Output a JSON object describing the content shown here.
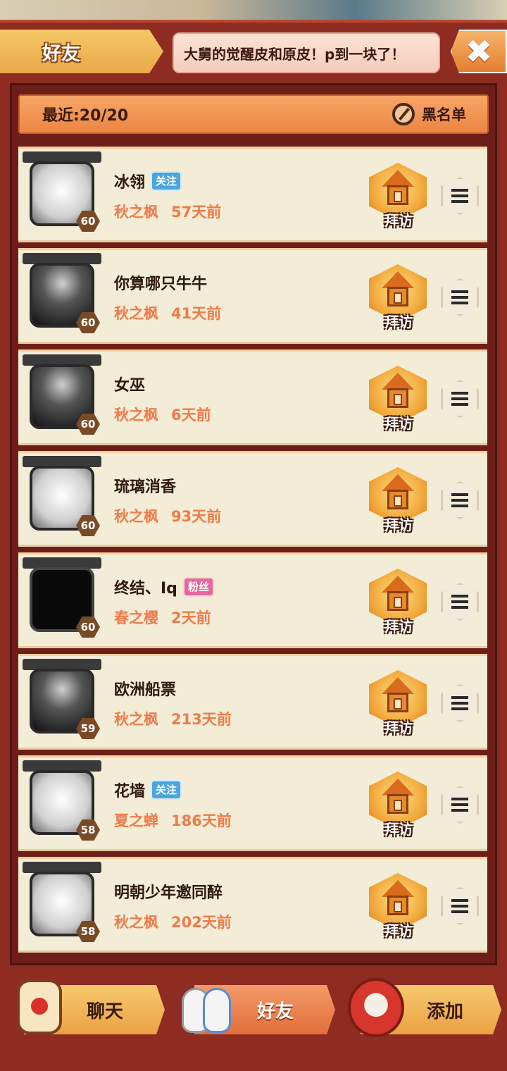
{
  "header": {
    "title": "好友",
    "marquee": "大舅的觉醒皮和原皮！p到一块了！",
    "close_icon": "✖"
  },
  "recent": {
    "label": "最近:20/20",
    "blacklist_label": "黑名单"
  },
  "friends": [
    {
      "name": "冰翎",
      "tag": "关注",
      "tag_type": "follow",
      "server": "秋之枫",
      "last_seen": "57天前",
      "level": "60",
      "avatar_style": "light"
    },
    {
      "name": "你算哪只牛牛",
      "tag": "",
      "tag_type": "",
      "server": "秋之枫",
      "last_seen": "41天前",
      "level": "60",
      "avatar_style": "dark"
    },
    {
      "name": "女巫",
      "tag": "",
      "tag_type": "",
      "server": "秋之枫",
      "last_seen": "6天前",
      "level": "60",
      "avatar_style": "dark"
    },
    {
      "name": "琉璃消香",
      "tag": "",
      "tag_type": "",
      "server": "秋之枫",
      "last_seen": "93天前",
      "level": "60",
      "avatar_style": "light"
    },
    {
      "name": "终结、Iq",
      "tag": "粉丝",
      "tag_type": "fan",
      "server": "春之樱",
      "last_seen": "2天前",
      "level": "60",
      "avatar_style": "black"
    },
    {
      "name": "欧洲船票",
      "tag": "",
      "tag_type": "",
      "server": "秋之枫",
      "last_seen": "213天前",
      "level": "59",
      "avatar_style": "dark"
    },
    {
      "name": "花墙",
      "tag": "关注",
      "tag_type": "follow",
      "server": "夏之蝉",
      "last_seen": "186天前",
      "level": "58",
      "avatar_style": "light"
    },
    {
      "name": "明朝少年邀同醉",
      "tag": "",
      "tag_type": "",
      "server": "秋之枫",
      "last_seen": "202天前",
      "level": "58",
      "avatar_style": "light"
    }
  ],
  "visit_label": "拜访",
  "tabs": {
    "chat": "聊天",
    "friends": "好友",
    "add": "添加"
  },
  "colors": {
    "frame": "#8e2c22",
    "accent_orange": "#ec8644",
    "server_text": "#ef7b49",
    "follow_tag": "#4aa6dc",
    "fan_tag": "#e5689c"
  }
}
